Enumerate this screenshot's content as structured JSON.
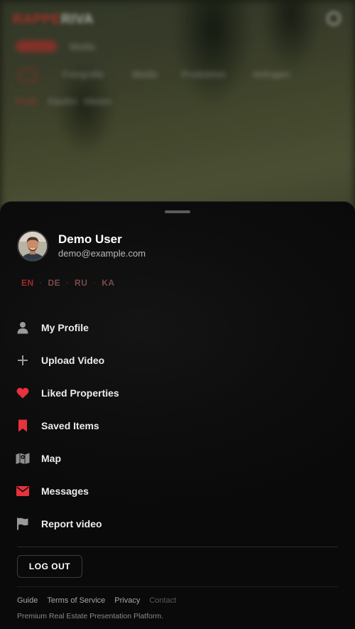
{
  "background": {
    "logo_primary": "RAPPE",
    "logo_secondary": "RIVA",
    "nav_items": [
      "Fotografie",
      "Media",
      "Produktion",
      "Anfragen"
    ],
    "filters": [
      "Profil",
      "Kaufen",
      "Mieten"
    ]
  },
  "sheet": {
    "user": {
      "name": "Demo User",
      "email": "demo@example.com",
      "avatar_icon": "user-avatar"
    },
    "languages": [
      {
        "code": "EN",
        "active": true
      },
      {
        "code": "DE",
        "active": false
      },
      {
        "code": "RU",
        "active": false
      },
      {
        "code": "KA",
        "active": false
      }
    ],
    "menu": [
      {
        "label": "My Profile",
        "icon": "person-icon",
        "color": "#9a9a9a"
      },
      {
        "label": "Upload Video",
        "icon": "plus-icon",
        "color": "#9a9a9a"
      },
      {
        "label": "Liked Properties",
        "icon": "heart-icon",
        "color": "#e8323c"
      },
      {
        "label": "Saved Items",
        "icon": "bookmark-icon",
        "color": "#e8323c"
      },
      {
        "label": "Map",
        "icon": "map-icon",
        "color": "#9a9a9a"
      },
      {
        "label": "Messages",
        "icon": "envelope-icon",
        "color": "#e8323c"
      },
      {
        "label": "Report video",
        "icon": "flag-icon",
        "color": "#9a9a9a"
      }
    ],
    "logout_label": "LOG OUT",
    "footer": {
      "links": [
        "Guide",
        "Terms of Service",
        "Privacy",
        "Contact"
      ],
      "tagline": "Premium Real Estate Presentation Platform."
    }
  },
  "colors": {
    "accent": "#e8323c",
    "sheet_bg": "#0d0d0d",
    "icon_gray": "#9a9a9a"
  }
}
